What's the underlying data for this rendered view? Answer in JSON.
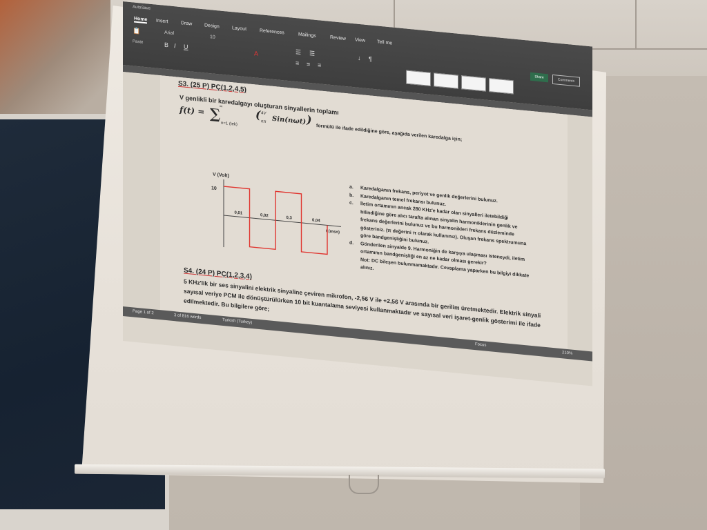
{
  "ribbon": {
    "app_title": "AutoSave",
    "tabs": [
      "Home",
      "Insert",
      "Draw",
      "Design",
      "Layout",
      "References",
      "Mailings",
      "Review",
      "View"
    ],
    "tell_me": "Tell me",
    "paste": "Paste",
    "font_name": "Arial",
    "font_size": "10",
    "share": "Share",
    "comments": "Comments"
  },
  "document": {
    "q3_heading": "S3. (25 P) PÇ(1,2,4,5)",
    "q3_intro": "V genlikli bir karedalgayı oluşturan sinyallerin toplamı",
    "formula_lhs": "f(t) = ",
    "formula_sum": "∑",
    "formula_upper": "∞",
    "formula_lower": "n=1 (tek)",
    "formula_frac_num": "4V",
    "formula_frac_den": "nπ",
    "formula_rhs": "Sin(nωt)",
    "formula_tail": "formülü ile ifade edildiğine göre, aşağıda verilen karedalga için;",
    "items": [
      {
        "label": "a.",
        "text": "Karedalganın frekans, periyot ve genlik değerlerini bulunuz."
      },
      {
        "label": "b.",
        "text": "Karedalganın temel frekansı bulunuz."
      },
      {
        "label": "c.",
        "text": "İletim ortamının ancak 280 KHz'e kadar olan sinyalleri iletebildiği"
      },
      {
        "label": "",
        "text": "bilindiğine göre alıcı tarafta alınan sinyalin harmoniklerinin genlik ve"
      },
      {
        "label": "",
        "text": "frekans değerlerini bulunuz ve bu harmonikleri frekans düzleminde"
      },
      {
        "label": "",
        "text": "gösteriniz. (π değerini π olarak kullanınız). Oluşan frekans spektrumuna"
      },
      {
        "label": "",
        "text": "göre bandgenişliğini bulunuz."
      },
      {
        "label": "d.",
        "text": "Gönderilen sinyalde 9. Harmoniğin de karşıya ulaşması isteneydi, iletim"
      },
      {
        "label": "",
        "text": "ortamının bandgenişliği en az ne kadar olması gerekir?"
      },
      {
        "label": "",
        "text": "Not: DC bileşen bulunmamaktadır. Cevaplama yaparken bu bilgiyi dikkate"
      },
      {
        "label": "",
        "text": "alınız."
      }
    ],
    "q4_heading": "S4. (24 P) PÇ(1,2,3,4)",
    "q4_lines": [
      "5 KHz'lik bir ses sinyalini elektrik sinyaline çeviren mikrofon, -2,56 V ile +2,56 V arasında bir gerilim üretmektedir. Elektrik sinyali",
      "sayısal veriye PCM ile dönüştürülürken 10 bit kuantalama seviyesi kullanmaktadır ve sayısal veri işaret-genlik gösterimi ile ifade",
      "edilmektedir. Bu bilgilere göre;"
    ]
  },
  "chart_data": {
    "type": "line",
    "ylabel": "V (Volt)",
    "xlabel": "t (msn)",
    "y_tick": "10",
    "x_ticks": [
      "0,01",
      "0,02",
      "0,3",
      "0,04"
    ],
    "x": [
      0,
      0.01,
      0.01,
      0.02,
      0.02,
      0.03,
      0.03,
      0.04,
      0.04
    ],
    "y": [
      10,
      10,
      -10,
      -10,
      10,
      10,
      -10,
      -10,
      0
    ],
    "ylim": [
      -10,
      10
    ],
    "xlim": [
      0,
      0.04
    ],
    "color": "#e0342e"
  },
  "status": {
    "page": "Page 1 of 2",
    "words": "3 of 816 words",
    "language": "Turkish (Turkey)",
    "focus": "Focus",
    "zoom": "210%"
  }
}
